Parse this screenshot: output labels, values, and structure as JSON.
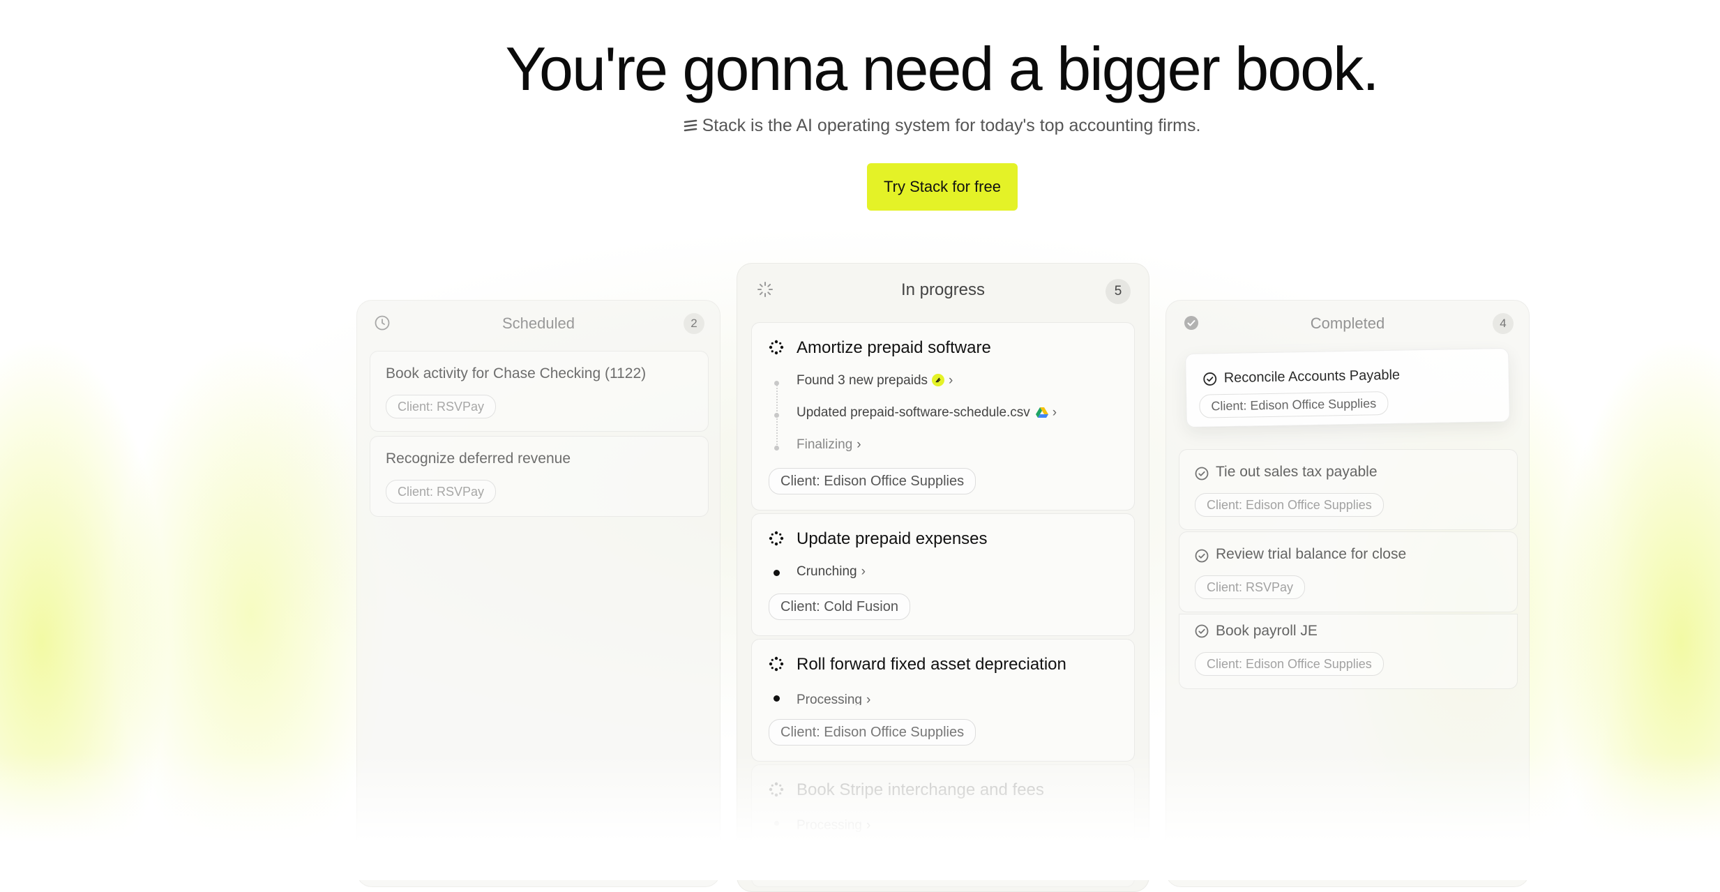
{
  "hero": {
    "title": "You're gonna need a bigger book.",
    "subtitle": "Stack is the AI operating system for today's top accounting firms.",
    "cta_label": "Try Stack for free"
  },
  "colors": {
    "accent": "#e4f227",
    "text": "#111111",
    "muted": "#888888"
  },
  "columns": {
    "scheduled": {
      "title": "Scheduled",
      "count": "2",
      "icon": "clock-icon",
      "cards": [
        {
          "title": "Book activity for Chase Checking (1122)",
          "client": "Client: RSVPay"
        },
        {
          "title": "Recognize deferred revenue",
          "client": "Client: RSVPay"
        }
      ]
    },
    "in_progress": {
      "title": "In progress",
      "count": "5",
      "icon": "loading-spinner-icon",
      "cards": [
        {
          "title": "Amortize prepaid software",
          "steps": [
            "Found 3 new prepaids",
            "Updated prepaid-software-schedule.csv",
            "Finalizing"
          ],
          "client": "Client: Edison Office Supplies"
        },
        {
          "title": "Update prepaid expenses",
          "steps": [
            "Crunching"
          ],
          "client": "Client: Cold Fusion"
        },
        {
          "title": "Roll forward fixed asset depreciation",
          "steps": [
            "Processing"
          ],
          "client": "Client: Edison Office Supplies"
        },
        {
          "title": "Book Stripe interchange and fees",
          "steps": [
            "Processing"
          ],
          "client": ""
        }
      ]
    },
    "completed": {
      "title": "Completed",
      "count": "4",
      "icon": "check-circle-icon",
      "cards": [
        {
          "title": "Reconcile Accounts Payable",
          "client": "Client: Edison Office Supplies"
        },
        {
          "title": "Tie out sales tax payable",
          "client": "Client: Edison Office Supplies"
        },
        {
          "title": "Review trial balance for close",
          "client": "Client: RSVPay"
        },
        {
          "title": "Book payroll JE",
          "client": "Client: Edison Office Supplies"
        }
      ]
    }
  }
}
